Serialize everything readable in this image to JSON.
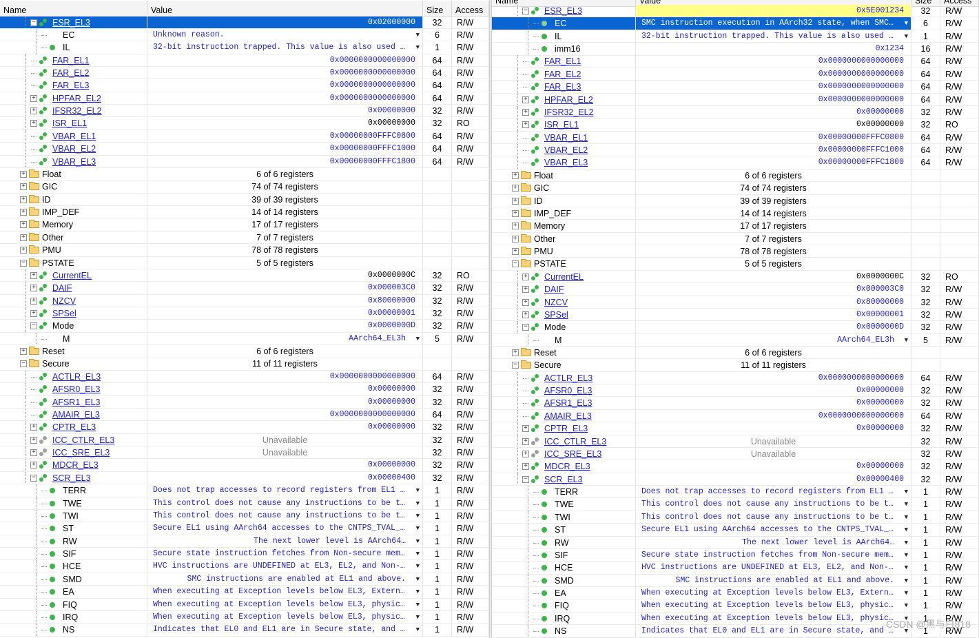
{
  "left_pane": {
    "header": {
      "name": "Name",
      "value": "Value",
      "size": "Size",
      "access": "Access"
    },
    "rows": [
      {
        "lvl": 3,
        "t": "c",
        "i": "reg",
        "n": "ESR_EL3",
        "k": true,
        "v": "0x02000000",
        "s": "32",
        "a": "R/W",
        "sel": true
      },
      {
        "lvl": 4,
        "t": "n",
        "i": "none",
        "n": "EC",
        "v": "Unknown reason.",
        "vt": "enum",
        "s": "6",
        "a": "R/W"
      },
      {
        "lvl": 4,
        "t": "n",
        "i": "fld",
        "n": "IL",
        "v": "32-bit instruction trapped. This value is also used …",
        "vt": "enum",
        "s": "1",
        "a": "R/W"
      },
      {
        "lvl": 3,
        "t": "n",
        "i": "reg",
        "n": "FAR_EL1",
        "k": true,
        "v": "0x0000000000000000",
        "s": "64",
        "a": "R/W"
      },
      {
        "lvl": 3,
        "t": "n",
        "i": "reg",
        "n": "FAR_EL2",
        "k": true,
        "v": "0x0000000000000000",
        "s": "64",
        "a": "R/W"
      },
      {
        "lvl": 3,
        "t": "n",
        "i": "reg",
        "n": "FAR_EL3",
        "k": true,
        "v": "0x0000000000000000",
        "s": "64",
        "a": "R/W"
      },
      {
        "lvl": 3,
        "t": "e",
        "i": "reg",
        "n": "HPFAR_EL2",
        "k": true,
        "v": "0x0000000000000000",
        "s": "64",
        "a": "R/W"
      },
      {
        "lvl": 3,
        "t": "e",
        "i": "reg",
        "n": "IFSR32_EL2",
        "k": true,
        "v": "0x00000000",
        "s": "32",
        "a": "R/W"
      },
      {
        "lvl": 3,
        "t": "e",
        "i": "reg",
        "n": "ISR_EL1",
        "k": true,
        "v": "0x00000000",
        "vt": "black",
        "s": "32",
        "a": "RO"
      },
      {
        "lvl": 3,
        "t": "n",
        "i": "reg",
        "n": "VBAR_EL1",
        "k": true,
        "v": "0x00000000FFFC0800",
        "s": "64",
        "a": "R/W"
      },
      {
        "lvl": 3,
        "t": "n",
        "i": "reg",
        "n": "VBAR_EL2",
        "k": true,
        "v": "0x00000000FFFC1000",
        "s": "64",
        "a": "R/W"
      },
      {
        "lvl": 3,
        "t": "n",
        "i": "reg",
        "n": "VBAR_EL3",
        "k": true,
        "v": "0x00000000FFFC1800",
        "s": "64",
        "a": "R/W"
      },
      {
        "lvl": 1,
        "t": "e",
        "i": "fold",
        "n": "Float",
        "v": "6 of 6 registers",
        "vt": "sum"
      },
      {
        "lvl": 1,
        "t": "e",
        "i": "fold",
        "n": "GIC",
        "v": "74 of 74 registers",
        "vt": "sum"
      },
      {
        "lvl": 1,
        "t": "e",
        "i": "fold",
        "n": "ID",
        "v": "39 of 39 registers",
        "vt": "sum"
      },
      {
        "lvl": 1,
        "t": "e",
        "i": "fold",
        "n": "IMP_DEF",
        "v": "14 of 14 registers",
        "vt": "sum"
      },
      {
        "lvl": 1,
        "t": "e",
        "i": "fold",
        "n": "Memory",
        "v": "17 of 17 registers",
        "vt": "sum"
      },
      {
        "lvl": 1,
        "t": "e",
        "i": "fold",
        "n": "Other",
        "v": "7 of 7 registers",
        "vt": "sum"
      },
      {
        "lvl": 1,
        "t": "e",
        "i": "fold",
        "n": "PMU",
        "v": "78 of 78 registers",
        "vt": "sum"
      },
      {
        "lvl": 1,
        "t": "c",
        "i": "fold",
        "n": "PSTATE",
        "v": "5 of 5 registers",
        "vt": "sum"
      },
      {
        "lvl": 3,
        "t": "e",
        "i": "reg",
        "n": "CurrentEL",
        "k": true,
        "v": "0x0000000C",
        "vt": "black",
        "s": "32",
        "a": "RO"
      },
      {
        "lvl": 3,
        "t": "e",
        "i": "reg",
        "n": "DAIF",
        "k": true,
        "v": "0x000003C0",
        "s": "32",
        "a": "R/W"
      },
      {
        "lvl": 3,
        "t": "e",
        "i": "reg",
        "n": "NZCV",
        "k": true,
        "v": "0x80000000",
        "s": "32",
        "a": "R/W"
      },
      {
        "lvl": 3,
        "t": "e",
        "i": "reg",
        "n": "SPSel",
        "k": true,
        "v": "0x00000001",
        "s": "32",
        "a": "R/W"
      },
      {
        "lvl": 3,
        "t": "c",
        "i": "reg",
        "n": "Mode",
        "v": "0x0000000D",
        "s": "32",
        "a": "R/W"
      },
      {
        "lvl": 4,
        "t": "n",
        "i": "none",
        "n": "M",
        "v": "AArch64_EL3h",
        "vt": "enumr",
        "s": "5",
        "a": "R/W"
      },
      {
        "lvl": 1,
        "t": "e",
        "i": "fold",
        "n": "Reset",
        "v": "6 of 6 registers",
        "vt": "sum"
      },
      {
        "lvl": 1,
        "t": "c",
        "i": "fold",
        "n": "Secure",
        "v": "11 of 11 registers",
        "vt": "sum"
      },
      {
        "lvl": 3,
        "t": "n",
        "i": "reg",
        "n": "ACTLR_EL3",
        "k": true,
        "v": "0x0000000000000000",
        "s": "64",
        "a": "R/W"
      },
      {
        "lvl": 3,
        "t": "n",
        "i": "reg",
        "n": "AFSR0_EL3",
        "k": true,
        "v": "0x00000000",
        "s": "32",
        "a": "R/W"
      },
      {
        "lvl": 3,
        "t": "n",
        "i": "reg",
        "n": "AFSR1_EL3",
        "k": true,
        "v": "0x00000000",
        "s": "32",
        "a": "R/W"
      },
      {
        "lvl": 3,
        "t": "n",
        "i": "reg",
        "n": "AMAIR_EL3",
        "k": true,
        "v": "0x0000000000000000",
        "s": "64",
        "a": "R/W"
      },
      {
        "lvl": 3,
        "t": "e",
        "i": "reg",
        "n": "CPTR_EL3",
        "k": true,
        "v": "0x00000000",
        "s": "32",
        "a": "R/W"
      },
      {
        "lvl": 3,
        "t": "e",
        "i": "gray",
        "n": "ICC_CTLR_EL3",
        "k": true,
        "v": "Unavailable",
        "vt": "unav",
        "s": "32",
        "a": "R/W"
      },
      {
        "lvl": 3,
        "t": "e",
        "i": "gray",
        "n": "ICC_SRE_EL3",
        "k": true,
        "v": "Unavailable",
        "vt": "unav",
        "s": "32",
        "a": "R/W"
      },
      {
        "lvl": 3,
        "t": "e",
        "i": "reg",
        "n": "MDCR_EL3",
        "k": true,
        "v": "0x00000000",
        "s": "32",
        "a": "R/W"
      },
      {
        "lvl": 3,
        "t": "c",
        "i": "reg",
        "n": "SCR_EL3",
        "k": true,
        "v": "0x00000400",
        "s": "32",
        "a": "R/W"
      },
      {
        "lvl": 4,
        "t": "n",
        "i": "fld",
        "n": "TERR",
        "v": "Does not trap accesses to record registers from EL1 …",
        "vt": "enum",
        "s": "1",
        "a": "R/W"
      },
      {
        "lvl": 4,
        "t": "n",
        "i": "fld",
        "n": "TWE",
        "v": "This control does not cause any instructions to be t…",
        "vt": "enum",
        "s": "1",
        "a": "R/W"
      },
      {
        "lvl": 4,
        "t": "n",
        "i": "fld",
        "n": "TWI",
        "v": "This control does not cause any instructions to be t…",
        "vt": "enum",
        "s": "1",
        "a": "R/W"
      },
      {
        "lvl": 4,
        "t": "n",
        "i": "fld",
        "n": "ST",
        "v": "Secure EL1 using AArch64 accesses to the CNTPS_TVAL_…",
        "vt": "enum",
        "s": "1",
        "a": "R/W"
      },
      {
        "lvl": 4,
        "t": "n",
        "i": "fld",
        "n": "RW",
        "v": "The next lower level is AArch64…",
        "vt": "enumr",
        "s": "1",
        "a": "R/W"
      },
      {
        "lvl": 4,
        "t": "n",
        "i": "fld",
        "n": "SIF",
        "v": "Secure state instruction fetches from Non-secure mem…",
        "vt": "enum",
        "s": "1",
        "a": "R/W"
      },
      {
        "lvl": 4,
        "t": "n",
        "i": "fld",
        "n": "HCE",
        "v": "HVC instructions are UNDEFINED at EL3, EL2, and Non-…",
        "vt": "enum",
        "s": "1",
        "a": "R/W"
      },
      {
        "lvl": 4,
        "t": "n",
        "i": "fld",
        "n": "SMD",
        "v": "SMC instructions are enabled at EL1 and above.",
        "vt": "enumr",
        "s": "1",
        "a": "R/W"
      },
      {
        "lvl": 4,
        "t": "n",
        "i": "fld",
        "n": "EA",
        "v": "When executing at Exception levels below EL3, Extern…",
        "vt": "enum",
        "s": "1",
        "a": "R/W"
      },
      {
        "lvl": 4,
        "t": "n",
        "i": "fld",
        "n": "FIQ",
        "v": "When executing at Exception levels below EL3, physic…",
        "vt": "enum",
        "s": "1",
        "a": "R/W"
      },
      {
        "lvl": 4,
        "t": "n",
        "i": "fld",
        "n": "IRQ",
        "v": "When executing at Exception levels below EL3, physic…",
        "vt": "enum",
        "s": "1",
        "a": "R/W"
      },
      {
        "lvl": 4,
        "t": "n",
        "i": "fld",
        "n": "NS",
        "v": "Indicates that EL0 and EL1 are in Secure state, and …",
        "vt": "enum",
        "s": "1",
        "a": "R/W"
      }
    ]
  },
  "right_pane": {
    "header": {
      "name": "Name",
      "value": "Value",
      "size": "Size",
      "access": "Access"
    },
    "rows": [
      {
        "lvl": 3,
        "t": "c",
        "i": "reg",
        "n": "ESR_EL3",
        "k": true,
        "v": "0x5E001234",
        "s": "32",
        "a": "R/W",
        "yel": true
      },
      {
        "lvl": 4,
        "t": "n",
        "i": "dim",
        "n": "EC",
        "v": "SMC instruction execution in AArch32 state, when SMC…",
        "vt": "enum",
        "s": "6",
        "a": "R/W",
        "sel": true
      },
      {
        "lvl": 4,
        "t": "n",
        "i": "fld",
        "n": "IL",
        "v": "32-bit instruction trapped. This value is also used …",
        "vt": "enum",
        "s": "1",
        "a": "R/W"
      },
      {
        "lvl": 4,
        "t": "n",
        "i": "fld",
        "n": "imm16",
        "v": "0x1234",
        "s": "16",
        "a": "R/W"
      },
      {
        "lvl": 3,
        "t": "n",
        "i": "reg",
        "n": "FAR_EL1",
        "k": true,
        "v": "0x0000000000000000",
        "s": "64",
        "a": "R/W"
      },
      {
        "lvl": 3,
        "t": "n",
        "i": "reg",
        "n": "FAR_EL2",
        "k": true,
        "v": "0x0000000000000000",
        "s": "64",
        "a": "R/W"
      },
      {
        "lvl": 3,
        "t": "n",
        "i": "reg",
        "n": "FAR_EL3",
        "k": true,
        "v": "0x0000000000000000",
        "s": "64",
        "a": "R/W"
      },
      {
        "lvl": 3,
        "t": "e",
        "i": "reg",
        "n": "HPFAR_EL2",
        "k": true,
        "v": "0x0000000000000000",
        "s": "64",
        "a": "R/W"
      },
      {
        "lvl": 3,
        "t": "e",
        "i": "reg",
        "n": "IFSR32_EL2",
        "k": true,
        "v": "0x00000000",
        "s": "32",
        "a": "R/W"
      },
      {
        "lvl": 3,
        "t": "e",
        "i": "reg",
        "n": "ISR_EL1",
        "k": true,
        "v": "0x00000000",
        "vt": "black",
        "s": "32",
        "a": "RO"
      },
      {
        "lvl": 3,
        "t": "n",
        "i": "reg",
        "n": "VBAR_EL1",
        "k": true,
        "v": "0x00000000FFFC0800",
        "s": "64",
        "a": "R/W"
      },
      {
        "lvl": 3,
        "t": "n",
        "i": "reg",
        "n": "VBAR_EL2",
        "k": true,
        "v": "0x00000000FFFC1000",
        "s": "64",
        "a": "R/W"
      },
      {
        "lvl": 3,
        "t": "n",
        "i": "reg",
        "n": "VBAR_EL3",
        "k": true,
        "v": "0x00000000FFFC1800",
        "s": "64",
        "a": "R/W"
      },
      {
        "lvl": 1,
        "t": "e",
        "i": "fold",
        "n": "Float",
        "v": "6 of 6 registers",
        "vt": "sum"
      },
      {
        "lvl": 1,
        "t": "e",
        "i": "fold",
        "n": "GIC",
        "v": "74 of 74 registers",
        "vt": "sum"
      },
      {
        "lvl": 1,
        "t": "e",
        "i": "fold",
        "n": "ID",
        "v": "39 of 39 registers",
        "vt": "sum"
      },
      {
        "lvl": 1,
        "t": "e",
        "i": "fold",
        "n": "IMP_DEF",
        "v": "14 of 14 registers",
        "vt": "sum"
      },
      {
        "lvl": 1,
        "t": "e",
        "i": "fold",
        "n": "Memory",
        "v": "17 of 17 registers",
        "vt": "sum"
      },
      {
        "lvl": 1,
        "t": "e",
        "i": "fold",
        "n": "Other",
        "v": "7 of 7 registers",
        "vt": "sum"
      },
      {
        "lvl": 1,
        "t": "e",
        "i": "fold",
        "n": "PMU",
        "v": "78 of 78 registers",
        "vt": "sum"
      },
      {
        "lvl": 1,
        "t": "c",
        "i": "fold",
        "n": "PSTATE",
        "v": "5 of 5 registers",
        "vt": "sum"
      },
      {
        "lvl": 3,
        "t": "e",
        "i": "reg",
        "n": "CurrentEL",
        "k": true,
        "v": "0x0000000C",
        "vt": "black",
        "s": "32",
        "a": "RO"
      },
      {
        "lvl": 3,
        "t": "e",
        "i": "reg",
        "n": "DAIF",
        "k": true,
        "v": "0x000003C0",
        "s": "32",
        "a": "R/W"
      },
      {
        "lvl": 3,
        "t": "e",
        "i": "reg",
        "n": "NZCV",
        "k": true,
        "v": "0x80000000",
        "s": "32",
        "a": "R/W"
      },
      {
        "lvl": 3,
        "t": "e",
        "i": "reg",
        "n": "SPSel",
        "k": true,
        "v": "0x00000001",
        "s": "32",
        "a": "R/W"
      },
      {
        "lvl": 3,
        "t": "c",
        "i": "reg",
        "n": "Mode",
        "v": "0x0000000D",
        "s": "32",
        "a": "R/W"
      },
      {
        "lvl": 4,
        "t": "n",
        "i": "none",
        "n": "M",
        "v": "AArch64_EL3h",
        "vt": "enumr",
        "s": "5",
        "a": "R/W"
      },
      {
        "lvl": 1,
        "t": "e",
        "i": "fold",
        "n": "Reset",
        "v": "6 of 6 registers",
        "vt": "sum"
      },
      {
        "lvl": 1,
        "t": "c",
        "i": "fold",
        "n": "Secure",
        "v": "11 of 11 registers",
        "vt": "sum"
      },
      {
        "lvl": 3,
        "t": "n",
        "i": "reg",
        "n": "ACTLR_EL3",
        "k": true,
        "v": "0x0000000000000000",
        "s": "64",
        "a": "R/W"
      },
      {
        "lvl": 3,
        "t": "n",
        "i": "reg",
        "n": "AFSR0_EL3",
        "k": true,
        "v": "0x00000000",
        "s": "32",
        "a": "R/W"
      },
      {
        "lvl": 3,
        "t": "n",
        "i": "reg",
        "n": "AFSR1_EL3",
        "k": true,
        "v": "0x00000000",
        "s": "32",
        "a": "R/W"
      },
      {
        "lvl": 3,
        "t": "n",
        "i": "reg",
        "n": "AMAIR_EL3",
        "k": true,
        "v": "0x0000000000000000",
        "s": "64",
        "a": "R/W"
      },
      {
        "lvl": 3,
        "t": "e",
        "i": "reg",
        "n": "CPTR_EL3",
        "k": true,
        "v": "0x00000000",
        "s": "32",
        "a": "R/W"
      },
      {
        "lvl": 3,
        "t": "e",
        "i": "gray",
        "n": "ICC_CTLR_EL3",
        "k": true,
        "v": "Unavailable",
        "vt": "unav",
        "s": "32",
        "a": "R/W"
      },
      {
        "lvl": 3,
        "t": "e",
        "i": "gray",
        "n": "ICC_SRE_EL3",
        "k": true,
        "v": "Unavailable",
        "vt": "unav",
        "s": "32",
        "a": "R/W"
      },
      {
        "lvl": 3,
        "t": "e",
        "i": "reg",
        "n": "MDCR_EL3",
        "k": true,
        "v": "0x00000000",
        "s": "32",
        "a": "R/W"
      },
      {
        "lvl": 3,
        "t": "c",
        "i": "reg",
        "n": "SCR_EL3",
        "k": true,
        "v": "0x00000400",
        "s": "32",
        "a": "R/W"
      },
      {
        "lvl": 4,
        "t": "n",
        "i": "fld",
        "n": "TERR",
        "v": "Does not trap accesses to record registers from EL1 …",
        "vt": "enum",
        "s": "1",
        "a": "R/W"
      },
      {
        "lvl": 4,
        "t": "n",
        "i": "fld",
        "n": "TWE",
        "v": "This control does not cause any instructions to be t…",
        "vt": "enum",
        "s": "1",
        "a": "R/W"
      },
      {
        "lvl": 4,
        "t": "n",
        "i": "fld",
        "n": "TWI",
        "v": "This control does not cause any instructions to be t…",
        "vt": "enum",
        "s": "1",
        "a": "R/W"
      },
      {
        "lvl": 4,
        "t": "n",
        "i": "fld",
        "n": "ST",
        "v": "Secure EL1 using AArch64 accesses to the CNTPS_TVAL_…",
        "vt": "enum",
        "s": "1",
        "a": "R/W"
      },
      {
        "lvl": 4,
        "t": "n",
        "i": "fld",
        "n": "RW",
        "v": "The next lower level is AArch64…",
        "vt": "enumr",
        "s": "1",
        "a": "R/W"
      },
      {
        "lvl": 4,
        "t": "n",
        "i": "fld",
        "n": "SIF",
        "v": "Secure state instruction fetches from Non-secure mem…",
        "vt": "enum",
        "s": "1",
        "a": "R/W"
      },
      {
        "lvl": 4,
        "t": "n",
        "i": "fld",
        "n": "HCE",
        "v": "HVC instructions are UNDEFINED at EL3, EL2, and Non-…",
        "vt": "enum",
        "s": "1",
        "a": "R/W"
      },
      {
        "lvl": 4,
        "t": "n",
        "i": "fld",
        "n": "SMD",
        "v": "SMC instructions are enabled at EL1 and above.",
        "vt": "enumr",
        "s": "1",
        "a": "R/W"
      },
      {
        "lvl": 4,
        "t": "n",
        "i": "fld",
        "n": "EA",
        "v": "When executing at Exception levels below EL3, Extern…",
        "vt": "enum",
        "s": "1",
        "a": "R/W"
      },
      {
        "lvl": 4,
        "t": "n",
        "i": "fld",
        "n": "FIQ",
        "v": "When executing at Exception levels below EL3, physic…",
        "vt": "enum",
        "s": "1",
        "a": "R/W"
      },
      {
        "lvl": 4,
        "t": "n",
        "i": "fld",
        "n": "IRQ",
        "v": "When executing at Exception levels below EL3, physic…",
        "vt": "enum",
        "s": "1",
        "a": "R/W"
      },
      {
        "lvl": 4,
        "t": "n",
        "i": "fld",
        "n": "NS",
        "v": "Indicates that EL0 and EL1 are in Secure state, and …",
        "vt": "enum",
        "s": "1",
        "a": "R/W"
      }
    ]
  },
  "watermark": "CSDN @黑与白818",
  "colors": {
    "selection": "#0a64d2",
    "link": "#1f1fd0",
    "changed_highlight": "#ffff88",
    "register_icon": "#3cb449",
    "folder_icon": "#f6d27a"
  }
}
